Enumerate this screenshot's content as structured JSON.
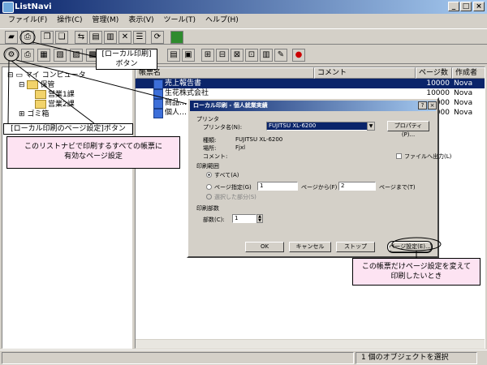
{
  "window": {
    "title": "ListNavi"
  },
  "menu": [
    "ファイル(F)",
    "操作(C)",
    "管理(M)",
    "表示(V)",
    "ツール(T)",
    "ヘルプ(H)"
  ],
  "tree": {
    "root": "マイ コンピュータ",
    "node1": "保管",
    "node2": "営業1課",
    "node3": "営業2課",
    "node4": "ゴミ箱"
  },
  "list": {
    "headers": [
      "帳票名",
      "コメント",
      "ページ数",
      "作成者"
    ],
    "rows": [
      {
        "name": "売上報告書",
        "pages": "10000",
        "author": "Nova"
      },
      {
        "name": "生花株式会社",
        "pages": "10000",
        "author": "Nova"
      },
      {
        "name": "商品…",
        "pages": "10000",
        "author": "Nova"
      },
      {
        "name": "個人…",
        "pages": "10000",
        "author": "Nova"
      }
    ]
  },
  "status": {
    "text": "1 個のオブジェクトを選択"
  },
  "dialog": {
    "title": "ローカル印刷 - 個人就業実績",
    "printer_group": "プリンタ",
    "printer_label": "プリンタ名(N):",
    "printer_value": "FUJITSU XL-6200",
    "properties_button": "プロパティ(P)...",
    "type_label": "種類:",
    "type_value": "FUJITSU XL-6200",
    "location_label": "場所:",
    "location_value": "Fjxl",
    "comment_label": "コメント:",
    "file_output": "ファイルへ出力(L)",
    "range_group": "印刷範囲",
    "range_all": "すべて(A)",
    "range_pages": "ページ指定(G)",
    "from_value": "1",
    "from_label": "ページから(F)",
    "to_value": "2",
    "to_label": "ページまで(T)",
    "range_selection": "選択した部分(S)",
    "copies_group": "印刷部数",
    "copies_label": "部数(C):",
    "copies_value": "1",
    "ok": "OK",
    "cancel": "キャンセル",
    "stop": "ストップ",
    "page_setup": "ページ設定(E)..."
  },
  "callouts": {
    "local_print": "[ローカル印刷]\nボタン",
    "page_setup_button": "[ローカル印刷のページ設定]ボタン",
    "all_reports": "このリストナビで印刷するすべての帳票に\n有効なページ設定",
    "this_report": "この帳票だけページ設定を変えて\n印刷したいとき"
  }
}
